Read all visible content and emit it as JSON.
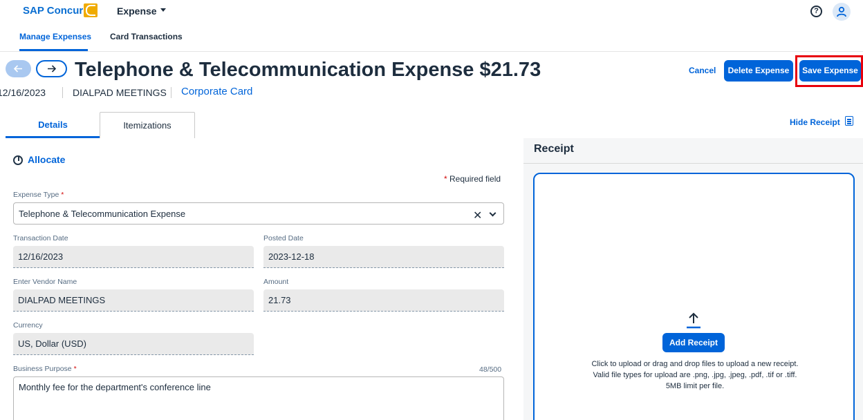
{
  "app": {
    "brand": "SAP Concur",
    "product": "Expense"
  },
  "nav": {
    "tabs": [
      {
        "label": "Manage Expenses",
        "active": true
      },
      {
        "label": "Card Transactions",
        "active": false
      }
    ]
  },
  "header": {
    "title": "Telephone & Telecommunication Expense $21.73",
    "date": "12/16/2023",
    "vendor": "DIALPAD MEETINGS",
    "payment_type": "Corporate Card",
    "actions": {
      "cancel": "Cancel",
      "delete": "Delete Expense",
      "save": "Save Expense"
    }
  },
  "tabs": {
    "details": "Details",
    "itemizations": "Itemizations",
    "hide_receipt": "Hide Receipt"
  },
  "form": {
    "allocate": "Allocate",
    "required_note": "Required field",
    "expense_type": {
      "label": "Expense Type",
      "value": "Telephone & Telecommunication Expense"
    },
    "transaction_date": {
      "label": "Transaction Date",
      "value": "12/16/2023"
    },
    "posted_date": {
      "label": "Posted Date",
      "value": "2023-12-18"
    },
    "vendor_name": {
      "label": "Enter Vendor Name",
      "value": "DIALPAD MEETINGS"
    },
    "amount": {
      "label": "Amount",
      "value": "21.73"
    },
    "currency": {
      "label": "Currency",
      "value": "US, Dollar (USD)"
    },
    "business_purpose": {
      "label": "Business Purpose",
      "value": "Monthly fee for the department's conference line",
      "counter": "48/500"
    }
  },
  "receipt": {
    "title": "Receipt",
    "add_button": "Add Receipt",
    "help_line1": "Click to upload or drag and drop files to upload a new receipt.",
    "help_line2": "Valid file types for upload are .png, .jpg, .jpeg, .pdf, .tif or .tiff.",
    "help_line3": "5MB limit per file."
  },
  "colors": {
    "accent": "#0064d9",
    "brand_mark": "#f0ab00",
    "required": "#d20a0a",
    "highlight": "#e8000b"
  },
  "icons": [
    "help-icon",
    "user-icon",
    "back-arrow-icon",
    "forward-arrow-icon",
    "receipt-icon",
    "allocate-icon",
    "clear-icon",
    "chevron-down-icon",
    "upload-icon"
  ]
}
